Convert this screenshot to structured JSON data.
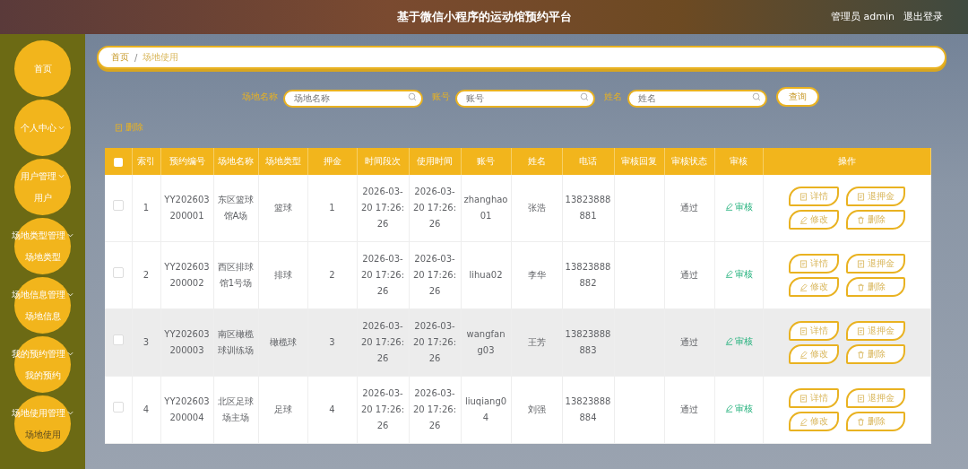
{
  "header": {
    "title": "基于微信小程序的运动馆预约平台",
    "user": "管理员 admin",
    "logout": "退出登录"
  },
  "sidebar": {
    "items": [
      {
        "label": "首页",
        "kind": "link"
      },
      {
        "label": "个人中心",
        "kind": "submenu"
      },
      {
        "label": "用户管理",
        "kind": "submenu",
        "children": [
          {
            "label": "用户",
            "selected": false
          }
        ]
      },
      {
        "label": "场地类型管理",
        "kind": "submenu",
        "children": [
          {
            "label": "场地类型",
            "selected": false
          }
        ]
      },
      {
        "label": "场地信息管理",
        "kind": "submenu",
        "children": [
          {
            "label": "场地信息",
            "selected": false
          }
        ]
      },
      {
        "label": "我的预约管理",
        "kind": "submenu",
        "children": [
          {
            "label": "我的预约",
            "selected": false
          }
        ]
      },
      {
        "label": "场地使用管理",
        "kind": "submenu",
        "children": [
          {
            "label": "场地使用",
            "selected": true
          }
        ]
      }
    ]
  },
  "breadcrumb": {
    "items": [
      "首页",
      "场地使用"
    ],
    "separator": "/"
  },
  "search": {
    "fields": [
      {
        "label": "场地名称",
        "placeholder": "场地名称"
      },
      {
        "label": "账号",
        "placeholder": "账号"
      },
      {
        "label": "姓名",
        "placeholder": "姓名"
      }
    ],
    "button": "查询"
  },
  "delete_button": "删除",
  "table": {
    "select_all_checked": false,
    "columns": [
      "索引",
      "预约编号",
      "场地名称",
      "场地类型",
      "押金",
      "时间段次",
      "使用时间",
      "账号",
      "姓名",
      "电话",
      "审核回复",
      "审核状态",
      "审核",
      "操作"
    ],
    "rows": [
      {
        "checked": false,
        "highlighted": false,
        "cells": [
          "1",
          "YY202603200001",
          "东区篮球馆A场",
          "篮球",
          "1",
          "2026-03-20 17:26:26",
          "2026-03-20 17:26:26",
          "zhanghao01",
          "张浩",
          "13823888881",
          "",
          "通过"
        ],
        "review": "审核",
        "actions": [
          "详情",
          "退押金",
          "修改",
          "删除"
        ]
      },
      {
        "checked": false,
        "highlighted": false,
        "cells": [
          "2",
          "YY202603200002",
          "西区排球馆1号场",
          "排球",
          "2",
          "2026-03-20 17:26:26",
          "2026-03-20 17:26:26",
          "lihua02",
          "李华",
          "13823888882",
          "",
          "通过"
        ],
        "review": "审核",
        "actions": [
          "详情",
          "退押金",
          "修改",
          "删除"
        ]
      },
      {
        "checked": false,
        "highlighted": true,
        "cells": [
          "3",
          "YY202603200003",
          "南区橄榄球训练场",
          "橄榄球",
          "3",
          "2026-03-20 17:26:26",
          "2026-03-20 17:26:26",
          "wangfang03",
          "王芳",
          "13823888883",
          "",
          "通过"
        ],
        "review": "审核",
        "actions": [
          "详情",
          "退押金",
          "修改",
          "删除"
        ]
      },
      {
        "checked": false,
        "highlighted": false,
        "cells": [
          "4",
          "YY202603200004",
          "北区足球场主场",
          "足球",
          "4",
          "2026-03-20 17:26:26",
          "2026-03-20 17:26:26",
          "liuqiang04",
          "刘强",
          "13823888884",
          "",
          "通过"
        ],
        "review": "审核",
        "actions": [
          "详情",
          "退押金",
          "修改",
          "删除"
        ]
      }
    ]
  }
}
